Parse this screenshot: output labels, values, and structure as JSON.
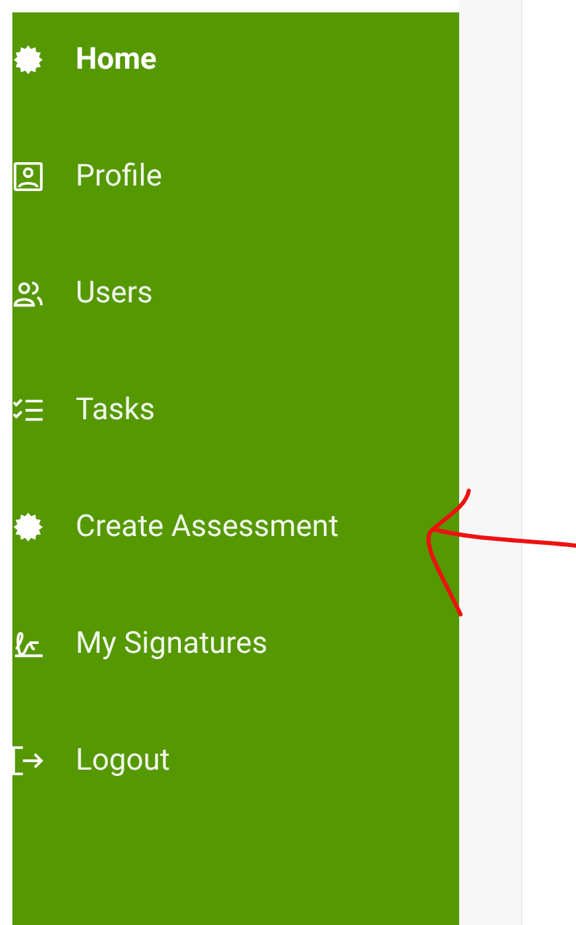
{
  "sidebar": {
    "items": [
      {
        "label": "Home",
        "kind": "badge",
        "selected": true
      },
      {
        "label": "Profile",
        "kind": "profile",
        "selected": false
      },
      {
        "label": "Users",
        "kind": "users",
        "selected": false
      },
      {
        "label": "Tasks",
        "kind": "tasks",
        "selected": false
      },
      {
        "label": "Create Assessment",
        "kind": "badge",
        "selected": false
      },
      {
        "label": "My Signatures",
        "kind": "signature",
        "selected": false
      },
      {
        "label": "Logout",
        "kind": "logout",
        "selected": false
      }
    ]
  }
}
